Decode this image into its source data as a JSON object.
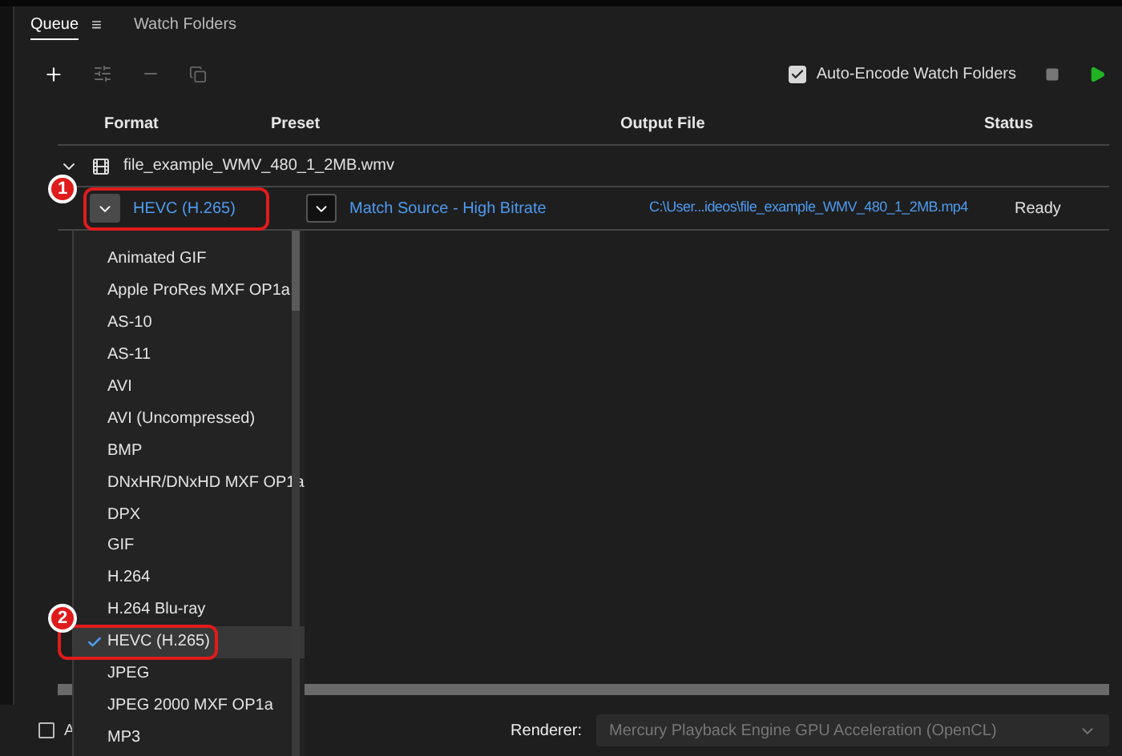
{
  "tabs": [
    {
      "label": "Queue",
      "selected": true,
      "menu": "≡"
    },
    {
      "label": "Watch Folders",
      "selected": false
    }
  ],
  "auto_encode": {
    "label": "Auto-Encode Watch Folders",
    "checked": true
  },
  "columns": [
    "Format",
    "Preset",
    "Output File",
    "Status"
  ],
  "source": {
    "name": "file_example_WMV_480_1_2MB.wmv",
    "expanded": true
  },
  "output": {
    "format": "HEVC (H.265)",
    "preset": "Match Source - High Bitrate",
    "file": "C:\\User...ideos\\file_example_WMV_480_1_2MB.mp4",
    "status": "Ready"
  },
  "format_menu": [
    {
      "label": "Animated GIF",
      "selected": false
    },
    {
      "label": "Apple ProRes MXF OP1a",
      "selected": false
    },
    {
      "label": "AS-10",
      "selected": false
    },
    {
      "label": "AS-11",
      "selected": false
    },
    {
      "label": "AVI",
      "selected": false
    },
    {
      "label": "AVI (Uncompressed)",
      "selected": false
    },
    {
      "label": "BMP",
      "selected": false
    },
    {
      "label": "DNxHR/DNxHD MXF OP1a",
      "selected": false
    },
    {
      "label": "DPX",
      "selected": false
    },
    {
      "label": "GIF",
      "selected": false
    },
    {
      "label": "H.264",
      "selected": false
    },
    {
      "label": "H.264 Blu-ray",
      "selected": false
    },
    {
      "label": "HEVC (H.265)",
      "selected": true
    },
    {
      "label": "JPEG",
      "selected": false
    },
    {
      "label": "JPEG 2000 MXF OP1a",
      "selected": false
    },
    {
      "label": "MP3",
      "selected": false
    }
  ],
  "callouts": [
    "1",
    "2"
  ],
  "footer": {
    "option": {
      "label": "A",
      "checked": false
    },
    "renderer_label": "Renderer:",
    "renderer": "Mercury Playback Engine GPU Acceleration (OpenCL)"
  }
}
